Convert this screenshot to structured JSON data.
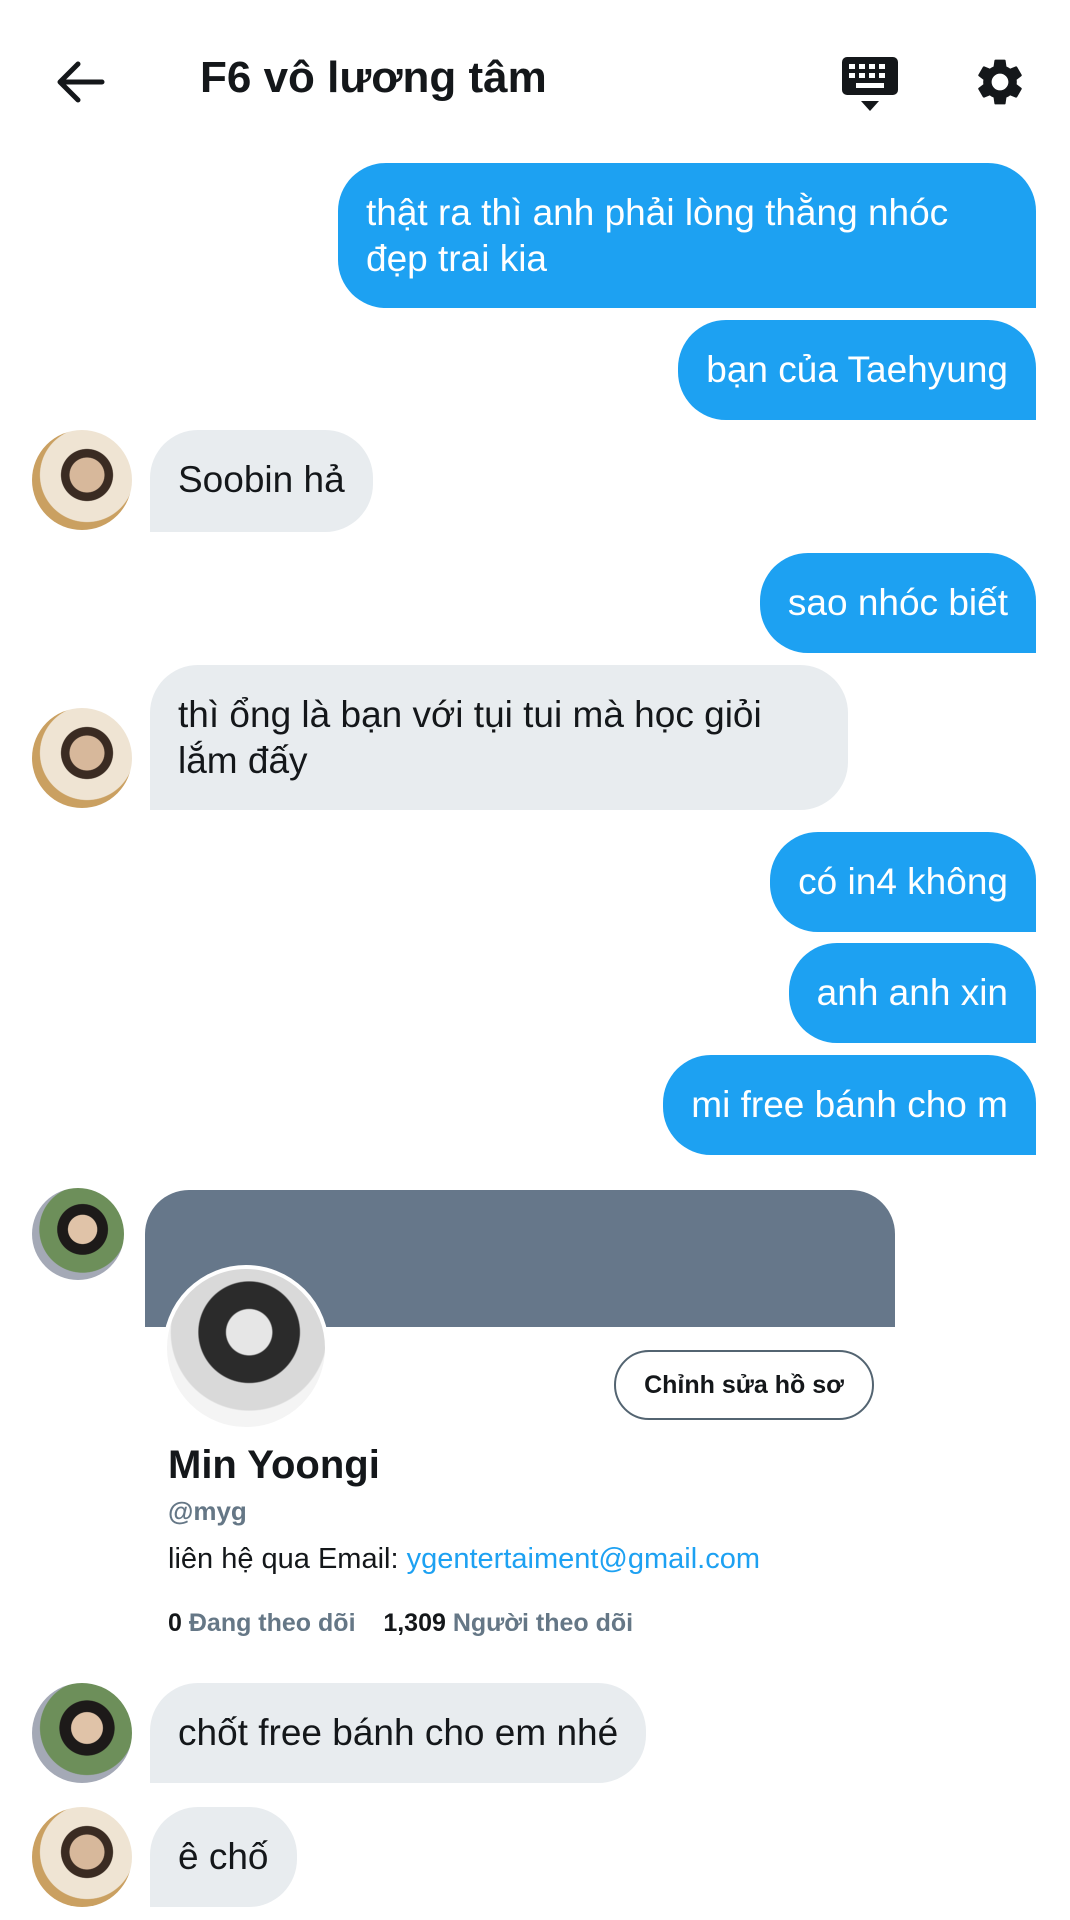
{
  "header": {
    "title": "F6 vô lương tâm"
  },
  "messages": {
    "m1": "thật ra thì anh phải lòng thằng nhóc đẹp trai kia",
    "m2": "bạn của Taehyung",
    "m3": "Soobin hả",
    "m4": "sao nhóc biết",
    "m5": "thì ổng là bạn với tụi tui mà học giỏi lắm đấy",
    "m6": "có in4 không",
    "m7": "anh anh xin",
    "m8": "mi free bánh cho m",
    "m9": "chốt free bánh cho em nhé",
    "m10": "ê chố"
  },
  "profile_card": {
    "edit_label": "Chỉnh sửa hồ sơ",
    "name": "Min Yoongi",
    "handle": "@myg",
    "bio_prefix": "liên hệ qua Email: ",
    "bio_email": "ygentertaiment@gmail.com",
    "following_count": "0",
    "following_label": "Đang theo dõi",
    "followers_count": "1,309",
    "followers_label": "Người theo dõi"
  },
  "colors": {
    "outgoing_bubble": "#1da1f2",
    "incoming_bubble": "#e8ecef",
    "banner": "#66778a",
    "link": "#1da1f2"
  },
  "icons": [
    "back-arrow-icon",
    "keyboard-icon",
    "gear-icon"
  ]
}
